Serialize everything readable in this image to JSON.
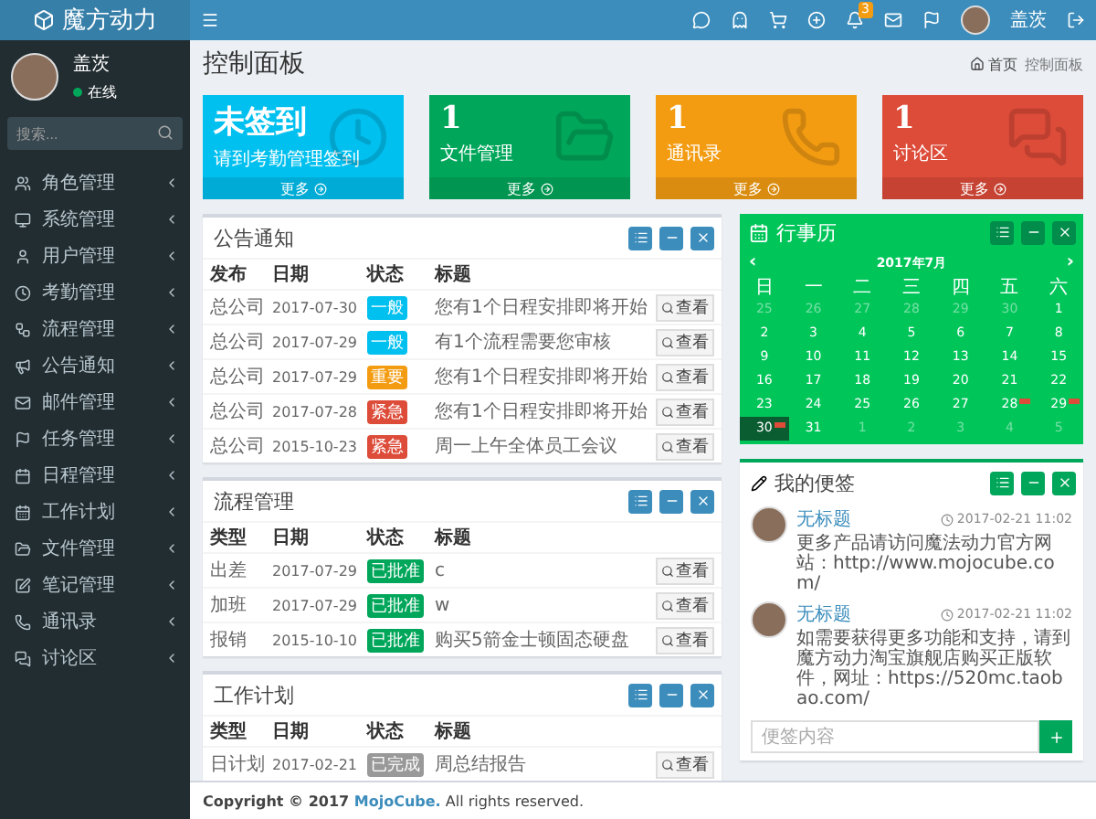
{
  "brand": {
    "name": "魔方动力"
  },
  "header": {
    "notification_count": "3",
    "user_name": "盖茨"
  },
  "sidebar": {
    "user": {
      "name": "盖茨",
      "status": "在线",
      "online": true
    },
    "search": {
      "placeholder": "搜索..."
    },
    "items": [
      {
        "label": "角色管理"
      },
      {
        "label": "系统管理"
      },
      {
        "label": "用户管理"
      },
      {
        "label": "考勤管理"
      },
      {
        "label": "流程管理"
      },
      {
        "label": "公告通知"
      },
      {
        "label": "邮件管理"
      },
      {
        "label": "任务管理"
      },
      {
        "label": "日程管理"
      },
      {
        "label": "工作计划"
      },
      {
        "label": "文件管理"
      },
      {
        "label": "笔记管理"
      },
      {
        "label": "通讯录"
      },
      {
        "label": "讨论区"
      }
    ]
  },
  "page": {
    "title": "控制面板",
    "breadcrumb": [
      "首页",
      "控制面板"
    ]
  },
  "stat_cards": [
    {
      "value": "未签到",
      "label": "请到考勤管理签到",
      "more": "更多",
      "color": "#00c0ef"
    },
    {
      "value": "1",
      "label": "文件管理",
      "more": "更多",
      "color": "#00a65a"
    },
    {
      "value": "1",
      "label": "通讯录",
      "more": "更多",
      "color": "#f39c12"
    },
    {
      "value": "1",
      "label": "讨论区",
      "more": "更多",
      "color": "#dd4b39"
    }
  ],
  "panels": [
    {
      "title": "公告通知",
      "columns": [
        "发布",
        "日期",
        "状态",
        "标题"
      ],
      "rows": [
        {
          "cells": [
            "总公司",
            "2017-07-30"
          ],
          "status": {
            "text": "一般",
            "color": "#00c0ef"
          },
          "title": "您有1个日程安排即将开始",
          "action": "查看"
        },
        {
          "cells": [
            "总公司",
            "2017-07-29"
          ],
          "status": {
            "text": "一般",
            "color": "#00c0ef"
          },
          "title": "有1个流程需要您审核",
          "action": "查看"
        },
        {
          "cells": [
            "总公司",
            "2017-07-29"
          ],
          "status": {
            "text": "重要",
            "color": "#f39c12"
          },
          "title": "您有1个日程安排即将开始",
          "action": "查看"
        },
        {
          "cells": [
            "总公司",
            "2017-07-28"
          ],
          "status": {
            "text": "紧急",
            "color": "#dd4b39"
          },
          "title": "您有1个日程安排即将开始",
          "action": "查看"
        },
        {
          "cells": [
            "总公司",
            "2015-10-23"
          ],
          "status": {
            "text": "紧急",
            "color": "#dd4b39"
          },
          "title": "周一上午全体员工会议",
          "action": "查看"
        }
      ]
    },
    {
      "title": "流程管理",
      "columns": [
        "类型",
        "日期",
        "状态",
        "标题"
      ],
      "rows": [
        {
          "cells": [
            "出差",
            "2017-07-29"
          ],
          "status": {
            "text": "已批准",
            "color": "#00a65a"
          },
          "title": "c",
          "action": "查看"
        },
        {
          "cells": [
            "加班",
            "2017-07-29"
          ],
          "status": {
            "text": "已批准",
            "color": "#00a65a"
          },
          "title": "w",
          "action": "查看"
        },
        {
          "cells": [
            "报销",
            "2015-10-10"
          ],
          "status": {
            "text": "已批准",
            "color": "#00a65a"
          },
          "title": "购买5箭金士顿固态硬盘",
          "action": "查看"
        }
      ]
    },
    {
      "title": "工作计划",
      "columns": [
        "类型",
        "日期",
        "状态",
        "标题"
      ],
      "rows": [
        {
          "cells": [
            "日计划",
            "2017-02-21"
          ],
          "status": {
            "text": "已完成",
            "color": "#999999"
          },
          "title": "周总结报告",
          "action": "查看"
        }
      ]
    }
  ],
  "calendar": {
    "title": "行事历",
    "month": "2017年7月",
    "prev": "‹",
    "next": "›",
    "weekdays": [
      "日",
      "一",
      "二",
      "三",
      "四",
      "五",
      "六"
    ],
    "days": [
      {
        "day": "25",
        "other_month": true,
        "selected": false,
        "event": false
      },
      {
        "day": "26",
        "other_month": true,
        "selected": false,
        "event": false
      },
      {
        "day": "27",
        "other_month": true,
        "selected": false,
        "event": false
      },
      {
        "day": "28",
        "other_month": true,
        "selected": false,
        "event": false
      },
      {
        "day": "29",
        "other_month": true,
        "selected": false,
        "event": false
      },
      {
        "day": "30",
        "other_month": true,
        "selected": false,
        "event": false
      },
      {
        "day": "1",
        "other_month": false,
        "selected": false,
        "event": false
      },
      {
        "day": "2",
        "other_month": false,
        "selected": false,
        "event": false
      },
      {
        "day": "3",
        "other_month": false,
        "selected": false,
        "event": false
      },
      {
        "day": "4",
        "other_month": false,
        "selected": false,
        "event": false
      },
      {
        "day": "5",
        "other_month": false,
        "selected": false,
        "event": false
      },
      {
        "day": "6",
        "other_month": false,
        "selected": false,
        "event": false
      },
      {
        "day": "7",
        "other_month": false,
        "selected": false,
        "event": false
      },
      {
        "day": "8",
        "other_month": false,
        "selected": false,
        "event": false
      },
      {
        "day": "9",
        "other_month": false,
        "selected": false,
        "event": false
      },
      {
        "day": "10",
        "other_month": false,
        "selected": false,
        "event": false
      },
      {
        "day": "11",
        "other_month": false,
        "selected": false,
        "event": false
      },
      {
        "day": "12",
        "other_month": false,
        "selected": false,
        "event": false
      },
      {
        "day": "13",
        "other_month": false,
        "selected": false,
        "event": false
      },
      {
        "day": "14",
        "other_month": false,
        "selected": false,
        "event": false
      },
      {
        "day": "15",
        "other_month": false,
        "selected": false,
        "event": false
      },
      {
        "day": "16",
        "other_month": false,
        "selected": false,
        "event": false
      },
      {
        "day": "17",
        "other_month": false,
        "selected": false,
        "event": false
      },
      {
        "day": "18",
        "other_month": false,
        "selected": false,
        "event": false
      },
      {
        "day": "19",
        "other_month": false,
        "selected": false,
        "event": false
      },
      {
        "day": "20",
        "other_month": false,
        "selected": false,
        "event": false
      },
      {
        "day": "21",
        "other_month": false,
        "selected": false,
        "event": false
      },
      {
        "day": "22",
        "other_month": false,
        "selected": false,
        "event": false
      },
      {
        "day": "23",
        "other_month": false,
        "selected": false,
        "event": false
      },
      {
        "day": "24",
        "other_month": false,
        "selected": false,
        "event": false
      },
      {
        "day": "25",
        "other_month": false,
        "selected": false,
        "event": false
      },
      {
        "day": "26",
        "other_month": false,
        "selected": false,
        "event": false
      },
      {
        "day": "27",
        "other_month": false,
        "selected": false,
        "event": false
      },
      {
        "day": "28",
        "other_month": false,
        "selected": false,
        "event": true
      },
      {
        "day": "29",
        "other_month": false,
        "selected": false,
        "event": true
      },
      {
        "day": "30",
        "other_month": false,
        "selected": true,
        "event": true
      },
      {
        "day": "31",
        "other_month": false,
        "selected": false,
        "event": false
      },
      {
        "day": "1",
        "other_month": true,
        "selected": false,
        "event": false
      },
      {
        "day": "2",
        "other_month": true,
        "selected": false,
        "event": false
      },
      {
        "day": "3",
        "other_month": true,
        "selected": false,
        "event": false
      },
      {
        "day": "4",
        "other_month": true,
        "selected": false,
        "event": false
      },
      {
        "day": "5",
        "other_month": true,
        "selected": false,
        "event": false
      }
    ]
  },
  "notes": {
    "title": "我的便签",
    "items": [
      {
        "author": "无标题",
        "time": "2017-02-21 11:02",
        "text": "更多产品请访问魔法动力官方网站：http://www.mojocube.com/"
      },
      {
        "author": "无标题",
        "time": "2017-02-21 11:02",
        "text": "如需要获得更多功能和支持，请到魔方动力淘宝旗舰店购买正版软件，网址：https://520mc.taobao.com/"
      }
    ],
    "input": {
      "placeholder": "便签内容"
    }
  },
  "footer": {
    "prefix": "Copyright © 2017 ",
    "link": "MojoCube.",
    "suffix": " All rights reserved."
  }
}
